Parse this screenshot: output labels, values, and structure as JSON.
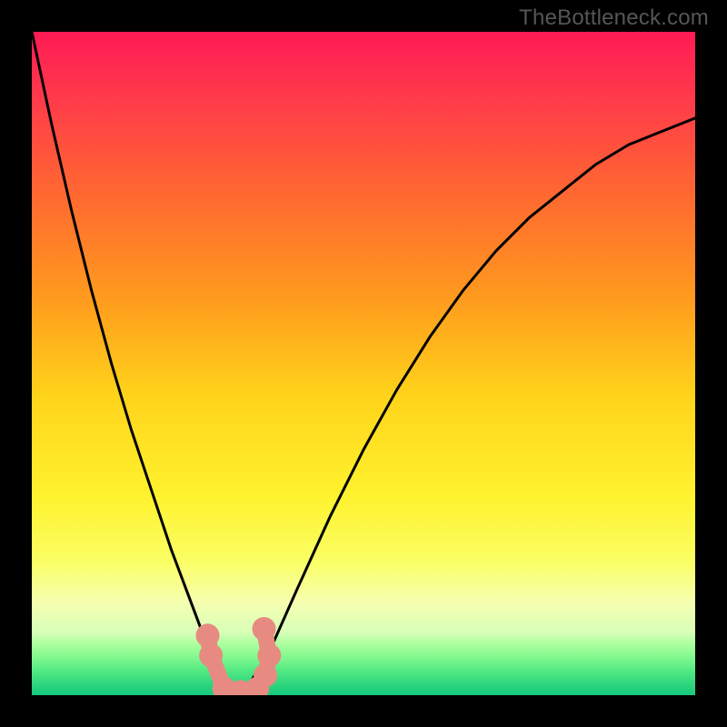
{
  "attribution": "TheBottleneck.com",
  "chart_data": {
    "type": "line",
    "title": "",
    "xlabel": "",
    "ylabel": "",
    "x_range": [
      0,
      1
    ],
    "y_range": [
      0,
      1
    ],
    "curve": {
      "description": "V-shaped bottleneck curve with minimum near x≈0.31; y is mismatch (0=ideal/green, 1=worst/red).",
      "x": [
        0.0,
        0.03,
        0.06,
        0.09,
        0.12,
        0.15,
        0.18,
        0.21,
        0.24,
        0.27,
        0.29,
        0.31,
        0.33,
        0.36,
        0.4,
        0.45,
        0.5,
        0.55,
        0.6,
        0.65,
        0.7,
        0.75,
        0.8,
        0.85,
        0.9,
        0.95,
        1.0
      ],
      "y": [
        1.0,
        0.86,
        0.73,
        0.61,
        0.5,
        0.4,
        0.31,
        0.22,
        0.14,
        0.06,
        0.02,
        0.0,
        0.02,
        0.07,
        0.16,
        0.27,
        0.37,
        0.46,
        0.54,
        0.61,
        0.67,
        0.72,
        0.76,
        0.8,
        0.83,
        0.85,
        0.87
      ]
    },
    "marker_cluster": {
      "description": "Pink dumbbell/bead markers near the curve minimum",
      "points_xy": [
        [
          0.265,
          0.09
        ],
        [
          0.27,
          0.06
        ],
        [
          0.29,
          0.01
        ],
        [
          0.315,
          0.005
        ],
        [
          0.34,
          0.01
        ],
        [
          0.352,
          0.03
        ],
        [
          0.358,
          0.06
        ],
        [
          0.35,
          0.1
        ]
      ],
      "color": "#e78b82"
    },
    "background_gradient": {
      "stops": [
        {
          "offset": 0.0,
          "color": "#ff1a55"
        },
        {
          "offset": 0.1,
          "color": "#ff3a4a"
        },
        {
          "offset": 0.25,
          "color": "#ff6a30"
        },
        {
          "offset": 0.4,
          "color": "#ff9a1e"
        },
        {
          "offset": 0.55,
          "color": "#ffd41a"
        },
        {
          "offset": 0.7,
          "color": "#fff22e"
        },
        {
          "offset": 0.8,
          "color": "#faff66"
        },
        {
          "offset": 0.86,
          "color": "#f6ffb0"
        },
        {
          "offset": 0.905,
          "color": "#d8ffb8"
        },
        {
          "offset": 0.925,
          "color": "#a8ff9c"
        },
        {
          "offset": 0.945,
          "color": "#7cf78c"
        },
        {
          "offset": 0.965,
          "color": "#4fe882"
        },
        {
          "offset": 0.985,
          "color": "#2bd47e"
        },
        {
          "offset": 1.0,
          "color": "#16c97e"
        }
      ]
    }
  }
}
